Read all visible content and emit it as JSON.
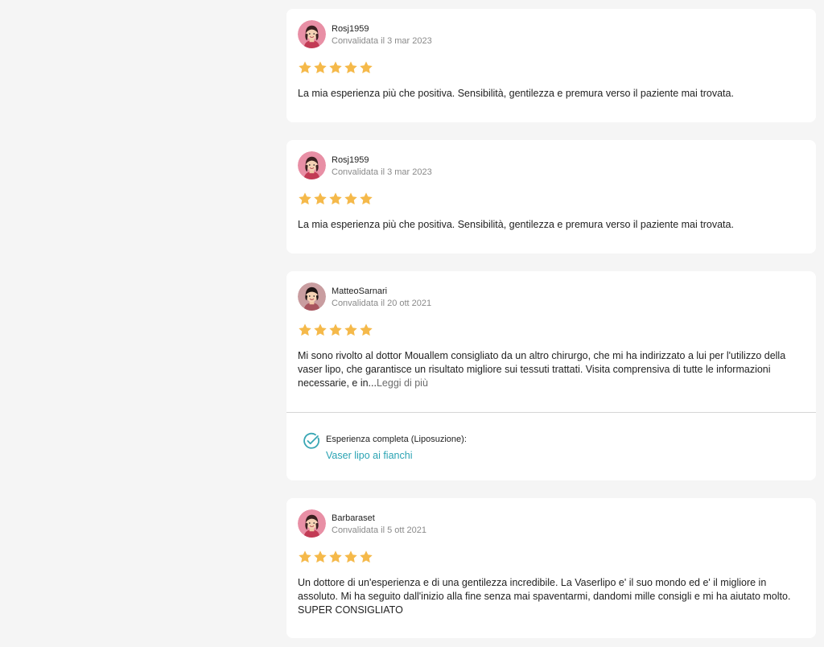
{
  "colors": {
    "page_background": "#f5f5f5",
    "card_background": "#ffffff",
    "star": "#f5b94a",
    "link": "#2aa3b3",
    "check_icon": "#3aa7b5"
  },
  "reviews": [
    {
      "author": "Rosj1959",
      "date": "Convalidata il 3 mar 2023",
      "rating": 5,
      "avatar_icon": "female-avatar-icon",
      "text": "La mia esperienza più che positiva. Sensibilità, gentilezza e premura verso il paziente mai trovata."
    },
    {
      "author": "Rosj1959",
      "date": "Convalidata il 3 mar 2023",
      "rating": 5,
      "avatar_icon": "female-avatar-icon",
      "text": "La mia esperienza più che positiva. Sensibilità, gentilezza e premura verso il paziente mai trovata."
    },
    {
      "author": "MatteoSarnari",
      "date": "Convalidata il 20 ott 2021",
      "rating": 5,
      "avatar_icon": "female-avatar-icon",
      "text": "Mi sono rivolto al dottor Mouallem consigliato da un altro chirurgo, che mi ha indirizzato a lui per l'utilizzo della vaser lipo, che garantisce un risultato migliore sui tessuti trattati. Visita comprensiva di tutte le informazioni necessarie, e in...",
      "read_more": "Leggi di più",
      "experience_label": "Esperienza completa (Liposuzione):",
      "experience_link": "Vaser lipo ai fianchi",
      "experience_icon": "check-circle-icon"
    },
    {
      "author": "Barbaraset",
      "date": "Convalidata il 5 ott 2021",
      "rating": 5,
      "avatar_icon": "female-avatar-icon",
      "text": "Un dottore di un'esperienza e di una gentilezza incredibile. La Vaserlipo e' il suo mondo ed e' il migliore in assoluto. Mi ha seguito dall'inizio alla fine senza mai spaventarmi, dandomi mille consigli e mi ha aiutato molto. SUPER CONSIGLIATO"
    }
  ]
}
